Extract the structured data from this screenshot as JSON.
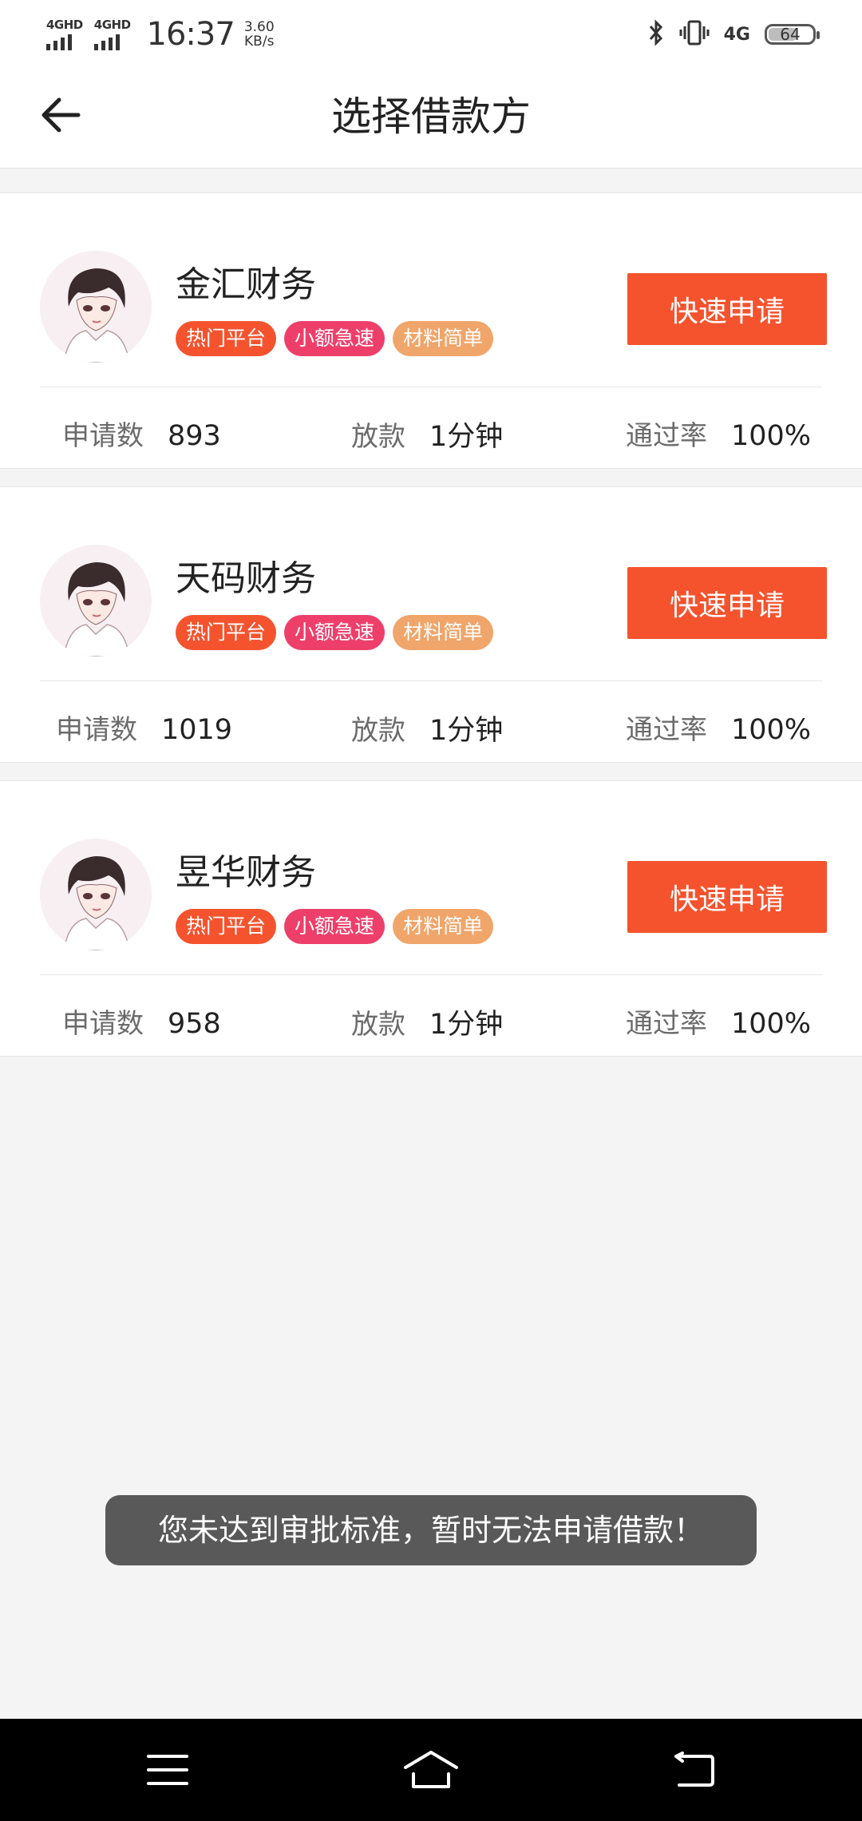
{
  "status_bar": {
    "signal1": "4GHD",
    "signal2": "4GHD",
    "time": "16:37",
    "speed_value": "3.60",
    "speed_unit": "KB/s",
    "network": "4G",
    "battery": "64",
    "battery_level": 0.64
  },
  "header": {
    "title": "选择借款方"
  },
  "lenders": [
    {
      "name": "金汇财务",
      "tags": [
        "热门平台",
        "小额急速",
        "材料简单"
      ],
      "apply_label": "快速申请",
      "stats": {
        "applications_label": "申请数",
        "applications": "893",
        "loan_label": "放款",
        "loan_time": "1分钟",
        "pass_label": "通过率",
        "pass_rate": "100%"
      }
    },
    {
      "name": "天码财务",
      "tags": [
        "热门平台",
        "小额急速",
        "材料简单"
      ],
      "apply_label": "快速申请",
      "stats": {
        "applications_label": "申请数",
        "applications": "1019",
        "loan_label": "放款",
        "loan_time": "1分钟",
        "pass_label": "通过率",
        "pass_rate": "100%"
      }
    },
    {
      "name": "昱华财务",
      "tags": [
        "热门平台",
        "小额急速",
        "材料简单"
      ],
      "apply_label": "快速申请",
      "stats": {
        "applications_label": "申请数",
        "applications": "958",
        "loan_label": "放款",
        "loan_time": "1分钟",
        "pass_label": "通过率",
        "pass_rate": "100%"
      }
    }
  ],
  "tag_colors": [
    "#f4532e",
    "#ee3f6b",
    "#f0a56a"
  ],
  "accent_color": "#f4532e",
  "toast": "您未达到审批标准，暂时无法申请借款！",
  "nav_icons": [
    "menu-icon",
    "home-icon",
    "back-icon"
  ]
}
